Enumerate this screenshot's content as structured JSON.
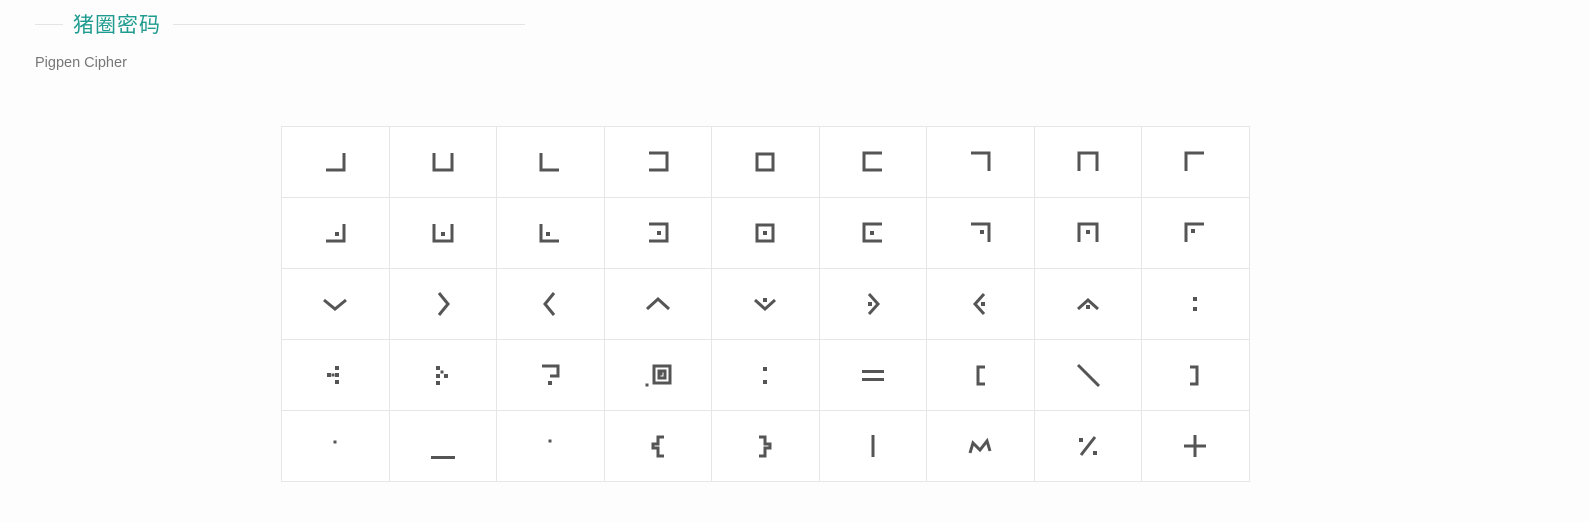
{
  "header": {
    "title": "猪圈密码",
    "subtitle": "Pigpen Cipher"
  },
  "colors": {
    "accent": "#1f9b8f",
    "glyph": "#555555",
    "grid_border": "#e6e6e6"
  },
  "cipher_grid": {
    "rows": 5,
    "columns": 9,
    "glyphs": [
      "corner-bottom-right",
      "open-top",
      "corner-bottom-left",
      "open-left",
      "box",
      "open-right",
      "corner-top-right",
      "open-bottom",
      "corner-top-left",
      "corner-bottom-right-dot",
      "open-top-dot",
      "corner-bottom-left-dot",
      "open-left-dot",
      "box-dot",
      "open-right-dot",
      "corner-top-right-dot",
      "open-bottom-dot",
      "corner-top-left-dot",
      "v-down",
      "v-right",
      "v-left",
      "v-up",
      "v-down-dot",
      "v-right-dot",
      "v-left-dot",
      "v-up-dot",
      "colon-dots",
      "dots-left",
      "dots-right",
      "question-glyph",
      "nested-box-glyph",
      "colon-glyph",
      "equals-glyph",
      "bracket-left",
      "backslash-glyph",
      "bracket-right",
      "small-dot-low",
      "underscore-glyph",
      "small-dot-mid",
      "brace-left",
      "brace-right",
      "pipe-glyph",
      "tilde-glyph",
      "percent-glyph",
      "plus-glyph"
    ]
  }
}
